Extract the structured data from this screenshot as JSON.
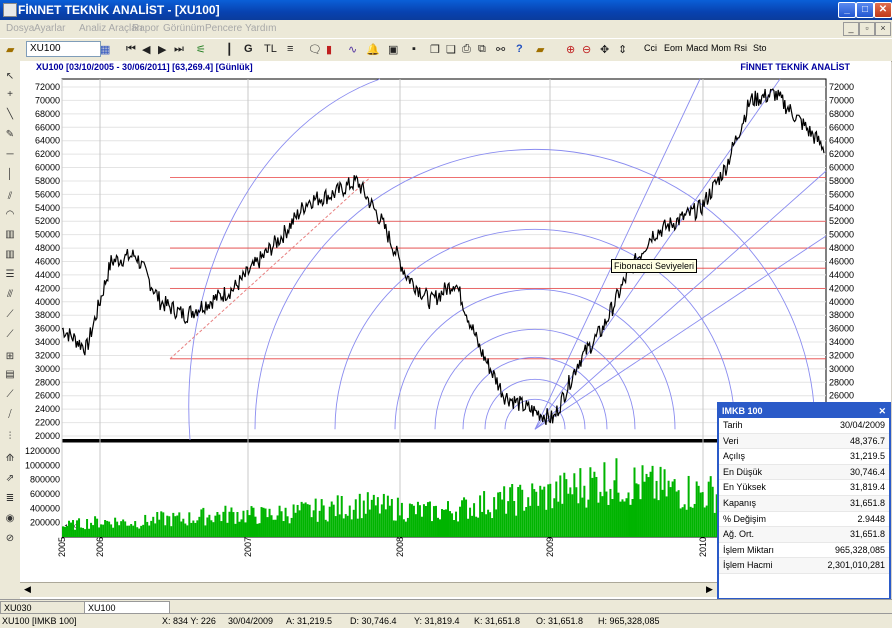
{
  "window": {
    "title": "FİNNET TEKNİK ANALİST - [XU100]"
  },
  "menu": [
    "Dosya",
    "Ayarlar",
    "Analiz Araçları",
    "Rapor",
    "Görünüm",
    "Pencere",
    "Yardım"
  ],
  "toolbar": {
    "symbol": "XU100",
    "g_label": "G",
    "tl_label": "TL",
    "help": "?"
  },
  "indicators": [
    "Cci",
    "Eom",
    "Macd",
    "Mom",
    "Rsi",
    "Sto"
  ],
  "chart": {
    "header": "XU100 [03/10/2005 - 30/06/2011] [63,269.4] [Günlük]",
    "brand": "FİNNET TEKNİK ANALİST",
    "price_ticks": [
      "72000",
      "70000",
      "68000",
      "66000",
      "64000",
      "62000",
      "60000",
      "58000",
      "56000",
      "54000",
      "52000",
      "50000",
      "48000",
      "46000",
      "44000",
      "42000",
      "40000",
      "38000",
      "36000",
      "34000",
      "32000",
      "30000",
      "28000",
      "26000",
      "24000",
      "22000",
      "20000"
    ],
    "volume_ticks": [
      "1200000",
      "1000000",
      "800000",
      "600000",
      "400000",
      "200000"
    ],
    "volume_scale": "10⁰",
    "years": [
      "2005",
      "2006",
      "2007",
      "2008",
      "2009",
      "2010"
    ],
    "tooltip": "Fibonacci Seviyeleri"
  },
  "chart_data": {
    "type": "line",
    "title": "XU100 [03/10/2005 - 30/06/2011] [63,269.4] [Günlük]",
    "x": [
      "2005-10",
      "2006-01",
      "2006-03",
      "2006-05",
      "2006-06",
      "2006-09",
      "2006-12",
      "2007-03",
      "2007-06",
      "2007-09",
      "2007-10",
      "2007-12",
      "2008-01",
      "2008-03",
      "2008-05",
      "2008-07",
      "2008-09",
      "2008-10",
      "2008-11",
      "2009-01",
      "2009-03",
      "2009-05",
      "2009-07",
      "2009-10",
      "2010-01",
      "2010-04",
      "2010-06",
      "2010-09",
      "2010-11",
      "2011-01",
      "2011-03",
      "2011-06"
    ],
    "series": [
      {
        "values": [
          36000,
          33000,
          46000,
          47000,
          40000,
          38000,
          40000,
          42000,
          46000,
          50000,
          55000,
          56000,
          58000,
          52000,
          44000,
          40000,
          43000,
          33000,
          26000,
          24000,
          22500,
          31000,
          36000,
          44000,
          50000,
          52000,
          54000,
          60000,
          70000,
          71000,
          67000,
          63000
        ]
      }
    ],
    "volume": [
      150000,
      200000,
      220000,
      200000,
      250000,
      250000,
      300000,
      320000,
      300000,
      330000,
      360000,
      400000,
      450000,
      420000,
      380000,
      350000,
      380000,
      450000,
      500000,
      550000,
      600000,
      700000,
      800000,
      750000,
      700000,
      650000,
      620000,
      600000,
      650000,
      600000,
      550000,
      500000
    ],
    "ylim": [
      20000,
      72000
    ],
    "volume_ylim": [
      0,
      1200000
    ],
    "overlays": [
      "Fibonacci arcs",
      "Fibonacci fan lines",
      "Fibonacci retracement levels"
    ]
  },
  "panel": {
    "title": "IMKB 100",
    "rows": [
      {
        "label": "Tarih",
        "value": "30/04/2009"
      },
      {
        "label": "Veri",
        "value": "48,376.7"
      },
      {
        "label": "Açılış",
        "value": "31,219.5"
      },
      {
        "label": "En Düşük",
        "value": "30,746.4"
      },
      {
        "label": "En Yüksek",
        "value": "31,819.4"
      },
      {
        "label": "Kapanış",
        "value": "31,651.8"
      },
      {
        "label": "% Değişim",
        "value": "2.9448"
      },
      {
        "label": "Ağ. Ort.",
        "value": "31,651.8"
      },
      {
        "label": "İşlem Miktarı",
        "value": "965,328,085"
      },
      {
        "label": "İşlem Hacmi",
        "value": "2,301,010,281"
      }
    ]
  },
  "tabs": [
    "XU030",
    "XU100"
  ],
  "status": [
    "XU100 [IMKB 100]",
    "X: 834 Y: 226",
    "30/04/2009",
    "A: 31,219.5",
    "D: 30,746.4",
    "Y: 31,819.4",
    "K: 31,651.8",
    "O: 31,651.8",
    "H: 965,328,085"
  ],
  "colors": {
    "price": "#000000",
    "volume": "#00b400",
    "fib": "#8a8cf0",
    "levels": "#e84040",
    "title_bar": "#0842b0"
  }
}
